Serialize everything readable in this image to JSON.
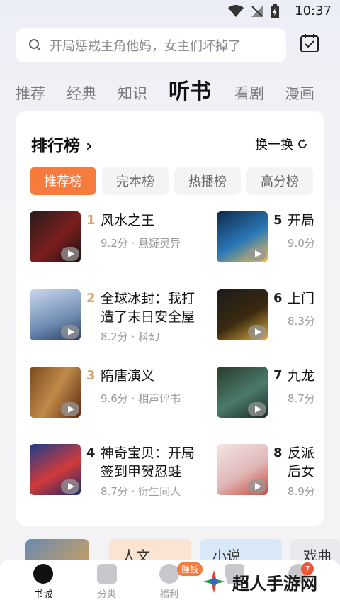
{
  "status_bar": {
    "time": "10:37"
  },
  "search": {
    "placeholder": "开局惩戒主角他妈，女主们坏掉了"
  },
  "tabs": [
    {
      "label": "推荐"
    },
    {
      "label": "经典"
    },
    {
      "label": "知识"
    },
    {
      "label": "听书"
    },
    {
      "label": "看剧"
    },
    {
      "label": "漫画"
    }
  ],
  "ranking": {
    "title": "排行榜",
    "refresh_label": "换一换",
    "pills": [
      {
        "label": "推荐榜"
      },
      {
        "label": "完本榜"
      },
      {
        "label": "热播榜"
      },
      {
        "label": "高分榜"
      }
    ],
    "left_items": [
      {
        "rank": "1",
        "title": "风水之王",
        "meta": "9.2分 · 悬疑灵异",
        "cover_text": ""
      },
      {
        "rank": "2",
        "title": "全球冰封：我打造了末日安全屋",
        "meta": "8.2分 · 科幻",
        "cover_text": ""
      },
      {
        "rank": "3",
        "title": "隋唐演义",
        "meta": "9.6分 · 相声评书",
        "cover_text": ""
      },
      {
        "rank": "4",
        "title": "神奇宝贝：开局签到甲贺忍蛙",
        "meta": "8.7分 · 衍生同人",
        "cover_text": ""
      }
    ],
    "right_items": [
      {
        "rank": "5",
        "title": "开局",
        "meta": "9.0分"
      },
      {
        "rank": "6",
        "title": "上门",
        "meta": "8.3分"
      },
      {
        "rank": "7",
        "title": "九龙",
        "meta": "8.7分"
      },
      {
        "rank": "8",
        "title": "反派后女",
        "meta": "8.9分"
      }
    ]
  },
  "strips": [
    {
      "label": ""
    },
    {
      "label": "人文"
    },
    {
      "label": "小说"
    },
    {
      "label": "戏曲"
    }
  ],
  "bottom_nav": [
    {
      "label": "书城"
    },
    {
      "label": "分类"
    },
    {
      "label": "福利"
    },
    {
      "label": ""
    },
    {
      "label": ""
    }
  ],
  "badges": {
    "earn": "赚钱",
    "count": "7"
  },
  "watermark": {
    "text": "超人手游网"
  },
  "colors": {
    "accent": "#f77b3d",
    "rank_gold": "#d7a86e"
  }
}
